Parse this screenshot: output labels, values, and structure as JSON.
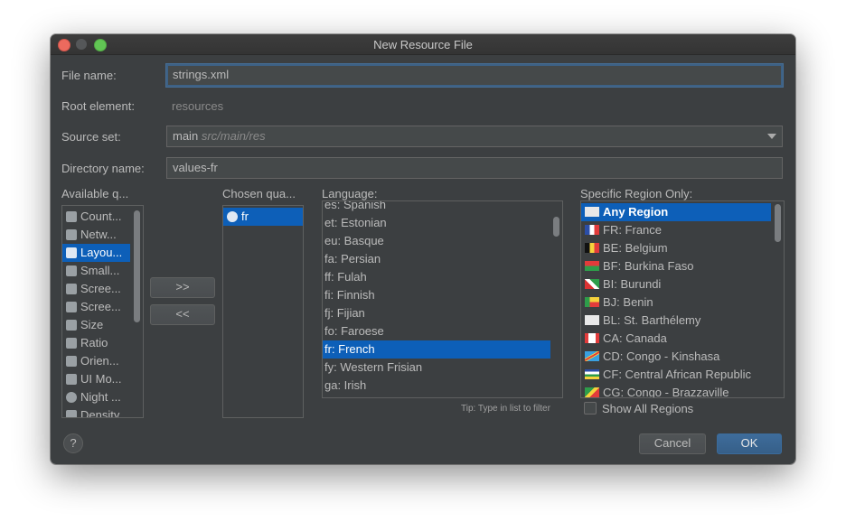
{
  "window": {
    "title": "New Resource File"
  },
  "form": {
    "file_name_label": "File name:",
    "file_name_value": "strings.xml",
    "root_element_label": "Root element:",
    "root_element_value": "resources",
    "source_set_label": "Source set:",
    "source_set_value": "main",
    "source_set_path": "src/main/res",
    "directory_label": "Directory name:",
    "directory_value": "values-fr"
  },
  "available": {
    "header": "Available q...",
    "items": [
      "Count...",
      "Netw...",
      "Layou...",
      "Small...",
      "Scree...",
      "Scree...",
      "Size",
      "Ratio",
      "Orien...",
      "UI Mo...",
      "Night ...",
      "Density"
    ],
    "selected_index": 2
  },
  "transfer": {
    "add": ">>",
    "remove": "<<"
  },
  "chosen": {
    "header": "Chosen qua...",
    "items": [
      "fr"
    ]
  },
  "language": {
    "header": "Language:",
    "items": [
      "es: Spanish",
      "et: Estonian",
      "eu: Basque",
      "fa: Persian",
      "ff: Fulah",
      "fi: Finnish",
      "fj: Fijian",
      "fo: Faroese",
      "fr: French",
      "fy: Western Frisian",
      "ga: Irish"
    ],
    "selected_index": 8,
    "tip": "Tip: Type in list to filter"
  },
  "region": {
    "header": "Specific Region Only:",
    "items": [
      "Any Region",
      "FR: France",
      "BE: Belgium",
      "BF: Burkina Faso",
      "BI: Burundi",
      "BJ: Benin",
      "BL: St. Barthélemy",
      "CA: Canada",
      "CD: Congo - Kinshasa",
      "CF: Central African Republic",
      "CG: Congo - Brazzaville"
    ],
    "selected_index": 0,
    "show_all_label": "Show All Regions"
  },
  "footer": {
    "help": "?",
    "cancel": "Cancel",
    "ok": "OK"
  },
  "colors": {
    "accent": "#0d5fb8",
    "background": "#3c3f41",
    "ok_button": "#365f88"
  }
}
